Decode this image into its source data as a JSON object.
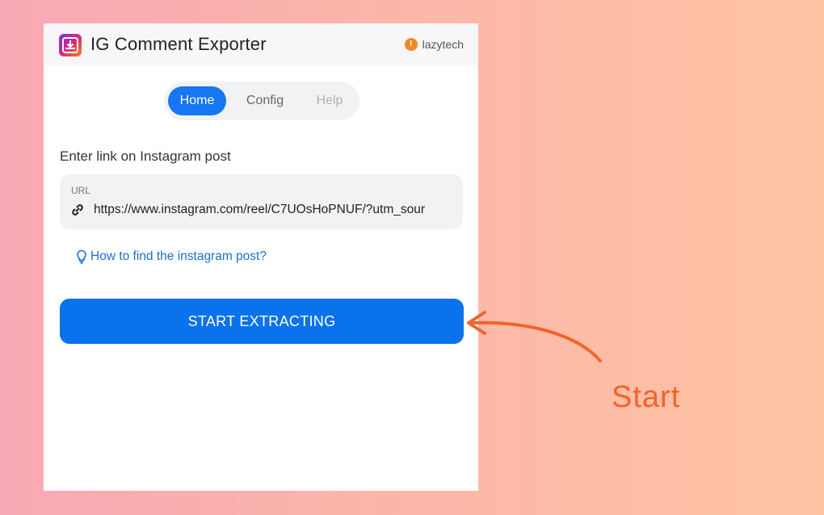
{
  "header": {
    "title": "IG Comment Exporter",
    "brand_icon": "I",
    "brand_name": "lazytech"
  },
  "tabs": [
    {
      "label": "Home",
      "active": true
    },
    {
      "label": "Config",
      "active": false
    },
    {
      "label": "Help",
      "active": false
    }
  ],
  "form": {
    "prompt": "Enter link on Instagram post",
    "url_label": "URL",
    "url_value": "https://www.instagram.com/reel/C7UOsHoPNUF/?utm_sour",
    "help_link": "How to find the instagram post?",
    "start_button": "START EXTRACTING"
  },
  "annotation": {
    "text": "Start",
    "color": "#f0642a"
  },
  "colors": {
    "accent": "#1677f0",
    "button": "#0a72ec",
    "link": "#1a6fd0"
  }
}
